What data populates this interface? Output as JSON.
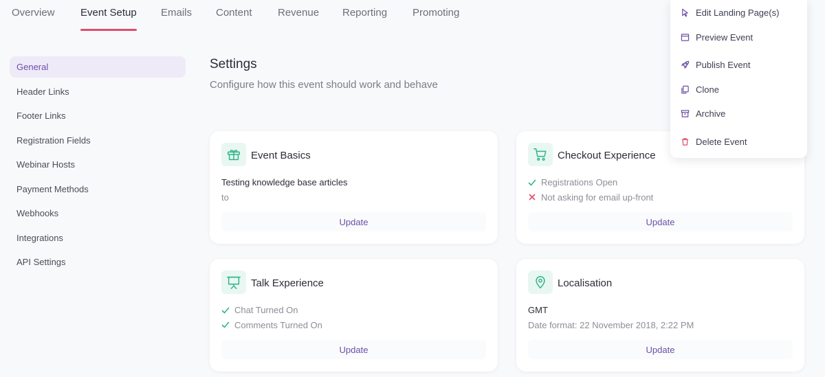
{
  "tabs": [
    {
      "label": "Overview"
    },
    {
      "label": "Event Setup"
    },
    {
      "label": "Emails"
    },
    {
      "label": "Content"
    },
    {
      "label": "Revenue"
    },
    {
      "label": "Reporting"
    },
    {
      "label": "Promoting"
    }
  ],
  "sidebar": {
    "items": [
      {
        "label": "General"
      },
      {
        "label": "Header Links"
      },
      {
        "label": "Footer Links"
      },
      {
        "label": "Registration Fields"
      },
      {
        "label": "Webinar Hosts"
      },
      {
        "label": "Payment Methods"
      },
      {
        "label": "Webhooks"
      },
      {
        "label": "Integrations"
      },
      {
        "label": "API Settings"
      }
    ]
  },
  "settings": {
    "title": "Settings",
    "subtitle": "Configure how this event should work and behave"
  },
  "cards": {
    "event_basics": {
      "title": "Event Basics",
      "line1": "Testing knowledge base articles",
      "line2": "to",
      "update": "Update",
      "icon": "gift-box-icon"
    },
    "checkout": {
      "title": "Checkout Experience",
      "line1": "Registrations Open",
      "line2": "Not asking for email up-front",
      "update": "Update",
      "icon": "cart-icon"
    },
    "talk": {
      "title": "Talk Experience",
      "line1": "Chat Turned On",
      "line2": "Comments Turned On",
      "update": "Update",
      "icon": "presentation-icon"
    },
    "localisation": {
      "title": "Localisation",
      "line1": "GMT",
      "line2": "Date format: 22 November 2018, 2:22 PM",
      "update": "Update",
      "icon": "map-pin-icon"
    }
  },
  "menu": {
    "items": [
      {
        "label": "Edit Landing Page(s)",
        "icon": "cursor-icon"
      },
      {
        "label": "Preview Event",
        "icon": "window-icon"
      },
      {
        "label": "Publish Event",
        "icon": "rocket-icon"
      },
      {
        "label": "Clone",
        "icon": "copy-icon"
      },
      {
        "label": "Archive",
        "icon": "archive-icon"
      },
      {
        "label": "Delete Event",
        "icon": "trash-icon"
      }
    ]
  },
  "colors": {
    "accent": "#6b4fa6",
    "tab_underline": "#e14c6e",
    "icon_green": "#2fb487",
    "check_green": "#2fb487",
    "cross_red": "#e14c6e",
    "delete_red": "#e14c6e"
  }
}
